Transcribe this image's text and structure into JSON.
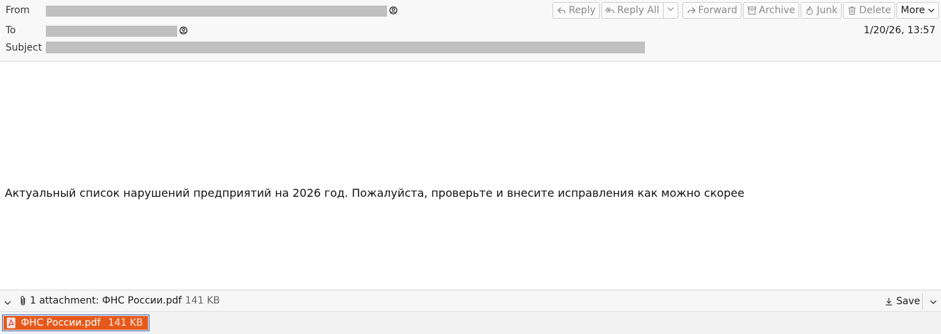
{
  "header": {
    "from_label": "From",
    "to_label": "To",
    "subject_label": "Subject",
    "date": "1/20/26, 13:57"
  },
  "toolbar": {
    "reply": "Reply",
    "reply_all": "Reply All",
    "forward": "Forward",
    "archive": "Archive",
    "junk": "Junk",
    "delete": "Delete",
    "more": "More"
  },
  "message": {
    "text": "Актуальный список нарушений предприятий на 2026 год. Пожалуйста, проверьте и внесите исправления как можно скорее"
  },
  "attachments": {
    "summary": "1 attachment: ФНС России.pdf",
    "total_size": "141 KB",
    "save_label": "Save",
    "items": [
      {
        "name": "ФНС России.pdf",
        "size": "141 KB"
      }
    ]
  },
  "icons": {
    "contact": "contact-icon",
    "reply": "reply-icon",
    "reply_all": "reply-all-icon",
    "forward": "forward-icon",
    "archive": "archive-icon",
    "junk": "junk-icon",
    "delete": "trash-icon",
    "paperclip": "paperclip-icon",
    "download": "download-icon",
    "pdf": "pdf-file-icon"
  },
  "colors": {
    "attachment_selected_bg": "#e55a1c",
    "attachment_focus_border": "#2b5fb4",
    "redaction": "#c0c0c0"
  }
}
